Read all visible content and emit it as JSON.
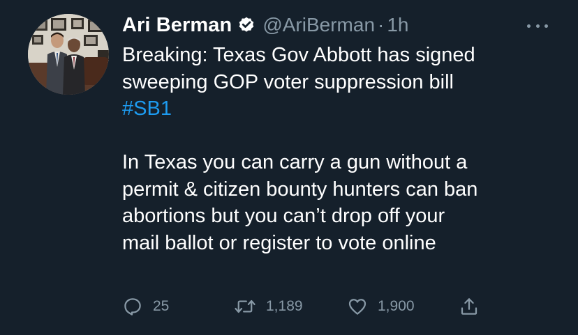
{
  "author": {
    "name": "Ari Berman",
    "handle": "@AriBerman",
    "separator": "·",
    "time": "1h"
  },
  "tweet": {
    "line1": "Breaking: Texas Gov Abbott has signed",
    "line2": "sweeping GOP voter suppression bill",
    "hashtag": "#SB1",
    "line4": "In Texas you can carry a gun without a",
    "line5": "permit & citizen bounty hunters can ban",
    "line6": "abortions but you can’t drop off your",
    "line7": "mail ballot or register to vote online"
  },
  "actions": {
    "reply_count": "25",
    "retweet_count": "1,189",
    "like_count": "1,900"
  },
  "colors": {
    "background": "#15202b",
    "text": "#ffffff",
    "secondary": "#8899a6",
    "link": "#1d9bf0"
  },
  "icons": [
    "verified-badge-icon",
    "more-options-icon",
    "reply-icon",
    "retweet-icon",
    "like-icon",
    "share-icon"
  ]
}
